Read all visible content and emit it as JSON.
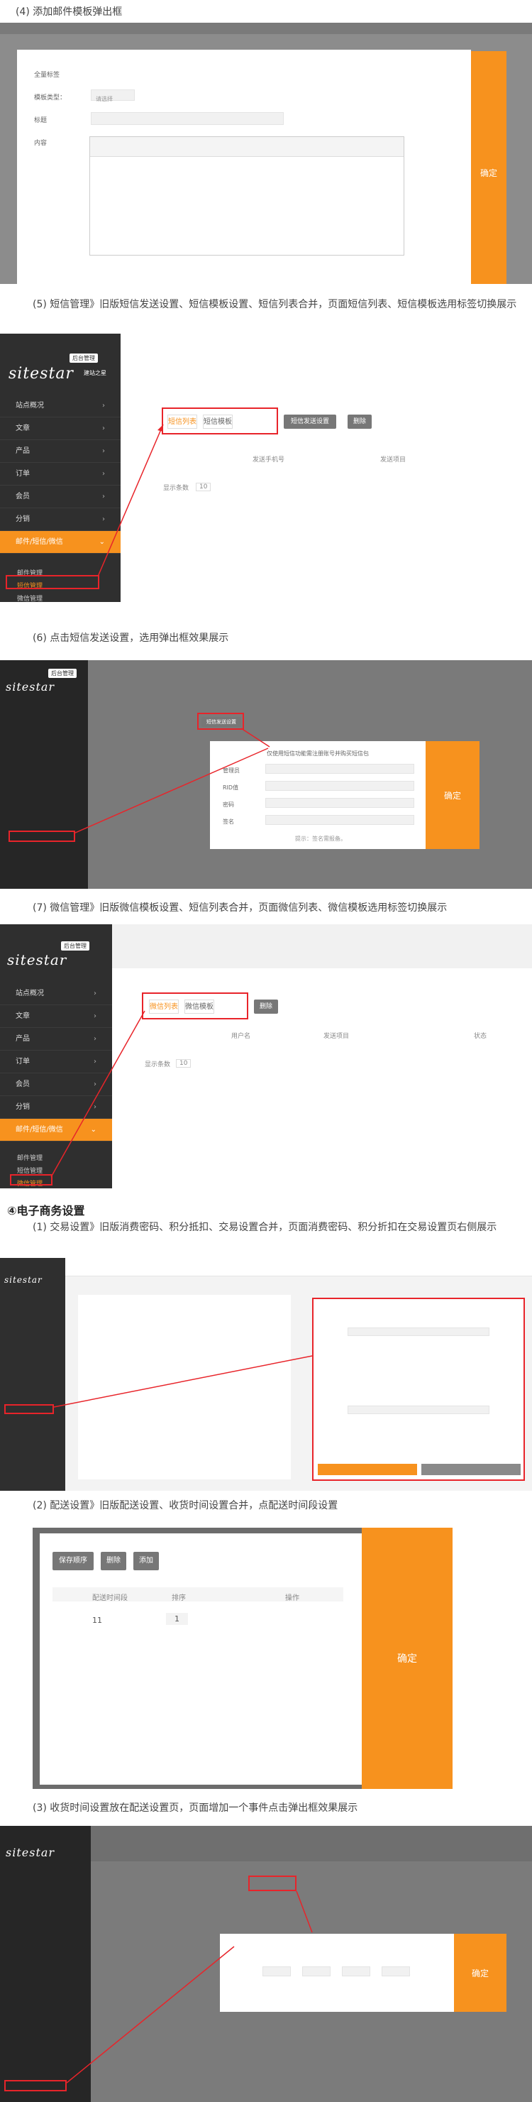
{
  "captions": {
    "c4": "(4) 添加邮件模板弹出框",
    "c5": "(5) 短信管理》旧版短信发送设置、短信模板设置、短信列表合并，页面短信列表、短信模板选用标签切换展示",
    "c6": "(6) 点击短信发送设置，选用弹出框效果展示",
    "c7": "(7) 微信管理》旧版微信模板设置、短信列表合并，页面微信列表、微信模板选用标签切换展示",
    "h4": "④电子商务设置",
    "e1": "(1) 交易设置》旧版消费密码、积分抵扣、交易设置合并，页面消费密码、积分折扣在交易设置页右侧展示",
    "e2": "(2) 配送设置》旧版配送设置、收货时间设置合并，点配送时间段设置",
    "e3": "(3) 收货时间设置放在配送设置页，页面增加一个事件点击弹出框效果展示"
  },
  "brand": {
    "logo": "sitestar",
    "sub": "建站之星",
    "badge": "后台管理"
  },
  "sidebar": [
    "站点概况",
    "文章",
    "产品",
    "订单",
    "会员",
    "分销",
    "邮件/短信/微信"
  ],
  "submenu": [
    "邮件管理",
    "短信管理",
    "微信管理"
  ],
  "common": {
    "ok": "确定",
    "show_count": "显示条数",
    "count_val": "10"
  },
  "mail_modal": {
    "r1": "全量标签",
    "r2": "模板类型：",
    "select": "请选择",
    "r3": "标题",
    "r4": "内容"
  },
  "sms": {
    "tab1": "短信列表",
    "tab2": "短信模板",
    "btn_set": "短信发送设置",
    "btn_del": "删除",
    "col1": "发送手机号",
    "col2": "发送项目"
  },
  "sms_modal": {
    "tip": "仅使用短信功能需注册账号并购买短信包",
    "f1": "管理员",
    "f2": "RID值",
    "f3": "密码",
    "f4": "签名",
    "note": "提示：签名需报备。"
  },
  "wx": {
    "tab1": "微信列表",
    "tab2": "微信模板",
    "btn_del": "删除",
    "col1": "用户名",
    "col2": "发送项目",
    "col3": "状态"
  },
  "delivery": {
    "btn1": "保存顺序",
    "btn2": "删除",
    "btn3": "添加",
    "col1": "配送时间段",
    "col2": "排序",
    "col3": "操作",
    "row_time": "11",
    "row_sort": "1"
  }
}
